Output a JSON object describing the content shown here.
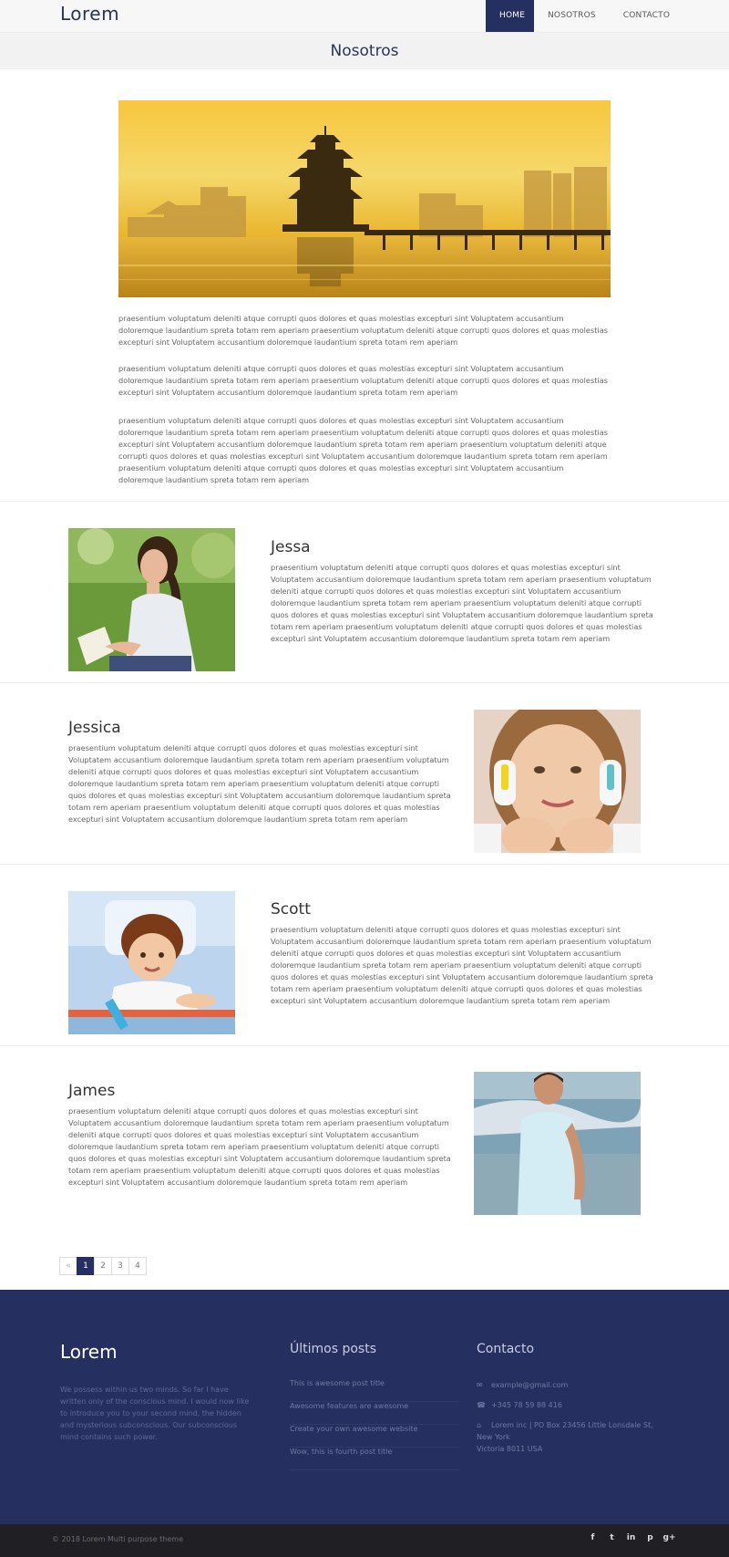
{
  "header": {
    "logo": "Lorem",
    "nav": [
      "HOME",
      "NOSOTROS",
      "CONTACTO"
    ],
    "page_title": "Nosotros"
  },
  "intro": {
    "paragraphs": [
      "praesentium voluptatum deleniti atque corrupti quos dolores et quas molestias excepturi sint Voluptatem accusantium doloremque laudantium spreta totam rem aperiam praesentium voluptatum deleniti atque corrupti quos dolores et quas molestias excepturi sint Voluptatem accusantium doloremque laudantium spreta totam rem aperiam",
      "praesentium voluptatum deleniti atque corrupti quos dolores et quas molestias excepturi sint Voluptatem accusantium doloremque laudantium spreta totam rem aperiam praesentium voluptatum deleniti atque corrupti quos dolores et quas molestias excepturi sint Voluptatem accusantium doloremque laudantium spreta totam rem aperiam",
      "praesentium voluptatum deleniti atque corrupti quos dolores et quas molestias excepturi sint Voluptatem accusantium doloremque laudantium spreta totam rem aperiam praesentium voluptatum deleniti atque corrupti quos dolores et quas molestias excepturi sint Voluptatem accusantium doloremque laudantium spreta totam rem aperiam praesentium voluptatum deleniti atque corrupti quos dolores et quas molestias excepturi sint Voluptatem accusantium doloremque laudantium spreta totam rem aperiam praesentium voluptatum deleniti atque corrupti quos dolores et quas molestias excepturi sint Voluptatem accusantium doloremque laudantium spreta totam rem aperiam"
    ]
  },
  "team": [
    {
      "name": "Jessa",
      "text": "praesentium voluptatum deleniti atque corrupti quos dolores et quas molestias excepturi sint Voluptatem accusantium doloremque laudantium spreta totam rem aperiam praesentium voluptatum deleniti atque corrupti quos dolores et quas molestias excepturi sint Voluptatem accusantium doloremque laudantium spreta totam rem aperiam praesentium voluptatum deleniti atque corrupti quos dolores et quas molestias excepturi sint Voluptatem accusantium doloremque laudantium spreta totam rem aperiam praesentium voluptatum deleniti atque corrupti quos dolores et quas molestias excepturi sint Voluptatem accusantium doloremque laudantium spreta totam rem aperiam"
    },
    {
      "name": "Jessica",
      "text": "praesentium voluptatum deleniti atque corrupti quos dolores et quas molestias excepturi sint Voluptatem accusantium doloremque laudantium spreta totam rem aperiam praesentium voluptatum deleniti atque corrupti quos dolores et quas molestias excepturi sint Voluptatem accusantium doloremque laudantium spreta totam rem aperiam praesentium voluptatum deleniti atque corrupti quos dolores et quas molestias excepturi sint Voluptatem accusantium doloremque laudantium spreta totam rem aperiam praesentium voluptatum deleniti atque corrupti quos dolores et quas molestias excepturi sint Voluptatem accusantium doloremque laudantium spreta totam rem aperiam"
    },
    {
      "name": "Scott",
      "text": "praesentium voluptatum deleniti atque corrupti quos dolores et quas molestias excepturi sint Voluptatem accusantium doloremque laudantium spreta totam rem aperiam praesentium voluptatum deleniti atque corrupti quos dolores et quas molestias excepturi sint Voluptatem accusantium doloremque laudantium spreta totam rem aperiam praesentium voluptatum deleniti atque corrupti quos dolores et quas molestias excepturi sint Voluptatem accusantium doloremque laudantium spreta totam rem aperiam praesentium voluptatum deleniti atque corrupti quos dolores et quas molestias excepturi sint Voluptatem accusantium doloremque laudantium spreta totam rem aperiam"
    },
    {
      "name": "James",
      "text": "praesentium voluptatum deleniti atque corrupti quos dolores et quas molestias excepturi sint Voluptatem accusantium doloremque laudantium spreta totam rem aperiam praesentium voluptatum deleniti atque corrupti quos dolores et quas molestias excepturi sint Voluptatem accusantium doloremque laudantium spreta totam rem aperiam praesentium voluptatum deleniti atque corrupti quos dolores et quas molestias excepturi sint Voluptatem accusantium doloremque laudantium spreta totam rem aperiam praesentium voluptatum deleniti atque corrupti quos dolores et quas molestias excepturi sint Voluptatem accusantium doloremque laudantium spreta totam rem aperiam"
    }
  ],
  "pagination": {
    "prev": "«",
    "pages": [
      "1",
      "2",
      "3",
      "4"
    ],
    "current": "1"
  },
  "footer": {
    "logo": "Lorem",
    "about": "We possess within us two minds. So far I have written only of the conscious mind. I would now like to introduce you to your second mind, the hidden and mysterious subconscious. Our subconscious mind contains such power.",
    "posts_title": "Últimos posts",
    "posts": [
      "This is awesome post title",
      "Awesome features are awesome",
      "Create your own awesome website",
      "Wow, this is fourth post title"
    ],
    "contact_title": "Contacto",
    "email": "example@gmail.com",
    "phone": "+345 78 59 88 416",
    "address_line1": "Lorem inc | PO Box 23456 Little Lonsdale St, New York",
    "address_line2": "Victoria 8011 USA",
    "copyright": "© 2018 Lorem Multi purpose theme",
    "social": [
      "f",
      "t",
      "in",
      "p",
      "g+"
    ]
  },
  "colors": {
    "brand": "#253061",
    "footer_bg": "#253061",
    "bottom_bar": "#1f1f24"
  }
}
